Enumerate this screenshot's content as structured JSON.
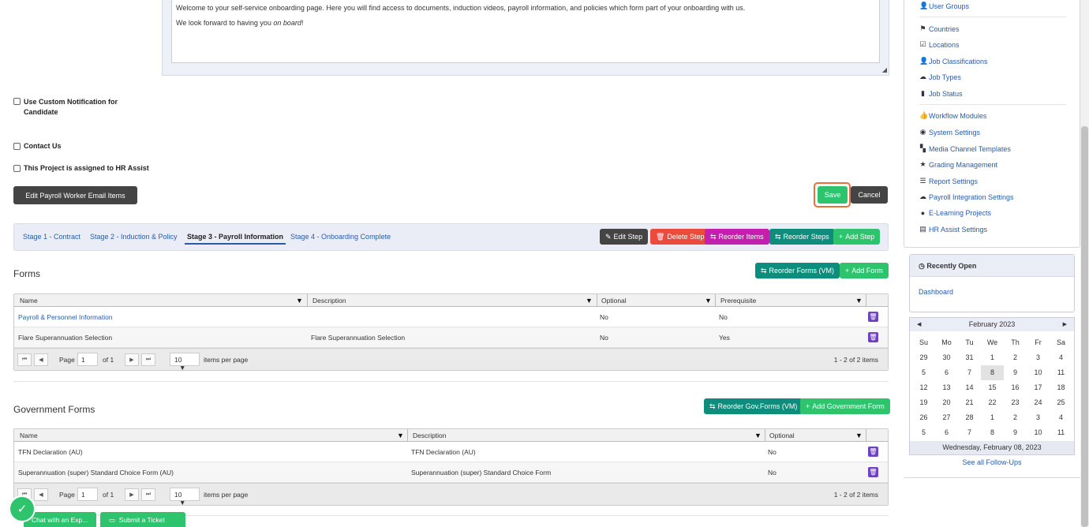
{
  "editor": {
    "line1": "Welcome to your self-service onboarding page. Here you will find access to documents, induction videos, payroll information, and policies which form part of your onboarding with us.",
    "line2_prefix": "We look forward to having you ",
    "line2_em": "on board",
    "line2_suffix": "!"
  },
  "checkboxes": {
    "custom_notification": "Use Custom Notification for Candidate",
    "contact_us": "Contact Us",
    "hr_assist": "This Project is assigned to HR Assist"
  },
  "buttons": {
    "edit_payroll": "Edit Payroll Worker Email Items",
    "save": "Save",
    "cancel": "Cancel",
    "edit_step": "Edit Step",
    "delete_step": "Delete Step",
    "reorder_items": "Reorder Items",
    "reorder_steps": "Reorder Steps",
    "add_step": "Add Step",
    "reorder_forms": "Reorder Forms (VM)",
    "add_form": "Add Form",
    "reorder_gov_forms": "Reorder Gov.Forms (VM)",
    "add_gov_form": "Add Government Form"
  },
  "stages": [
    {
      "label": "Stage 1 - Contract"
    },
    {
      "label": "Stage 2 - Induction & Policy"
    },
    {
      "label": "Stage 3 - Payroll Information"
    },
    {
      "label": "Stage 4 - Onboarding Complete"
    }
  ],
  "forms": {
    "title": "Forms",
    "columns": [
      "Name",
      "Description",
      "Optional",
      "Prerequisite"
    ],
    "rows": [
      {
        "name": "Payroll & Personnel Information",
        "description": "",
        "optional": "No",
        "prerequisite": "No"
      },
      {
        "name": "Flare Superannuation Selection",
        "description": "Flare Superannuation Selection",
        "optional": "No",
        "prerequisite": "Yes"
      }
    ],
    "pager": {
      "page_label": "Page",
      "page": "1",
      "of": "of 1",
      "per_page": "10",
      "per_page_label": "items per page",
      "summary": "1 - 2 of 2 items"
    }
  },
  "gov_forms": {
    "title": "Government Forms",
    "columns": [
      "Name",
      "Description",
      "Optional"
    ],
    "rows": [
      {
        "name": "TFN Declaration (AU)",
        "description": "TFN Declaration (AU)",
        "optional": "No"
      },
      {
        "name": "Superannuation (super) Standard Choice Form (AU)",
        "description": "Superannuation (super) Standard Choice Form",
        "optional": "No"
      }
    ],
    "pager": {
      "page_label": "Page",
      "page": "1",
      "of": "of 1",
      "per_page": "10",
      "per_page_label": "items per page",
      "summary": "1 - 2 of 2 items"
    }
  },
  "sidebar": {
    "items": [
      {
        "label": "User Groups",
        "icon": "user-icon"
      },
      {
        "label": "Countries",
        "icon": "flag-icon"
      },
      {
        "label": "Locations",
        "icon": "check-square-icon"
      },
      {
        "label": "Job Classifications",
        "icon": "user-icon"
      },
      {
        "label": "Job Types",
        "icon": "cloud-icon"
      },
      {
        "label": "Job Status",
        "icon": "book-icon"
      },
      {
        "label": "Workflow Modules",
        "icon": "thumbs-up-icon"
      },
      {
        "label": "System Settings",
        "icon": "globe-icon"
      },
      {
        "label": "Media Channel Templates",
        "icon": "media-icon"
      },
      {
        "label": "Grading Management",
        "icon": "star-icon"
      },
      {
        "label": "Report Settings",
        "icon": "list-icon"
      },
      {
        "label": "Payroll Integration Settings",
        "icon": "cloud-icon"
      },
      {
        "label": "E-Learning Projects",
        "icon": "apple-icon"
      },
      {
        "label": "HR Assist Settings",
        "icon": "briefcase-icon"
      }
    ]
  },
  "recent": {
    "title": "Recently Open",
    "item": "Dashboard"
  },
  "calendar": {
    "month": "February 2023",
    "weekdays": [
      "Su",
      "Mo",
      "Tu",
      "We",
      "Th",
      "Fr",
      "Sa"
    ],
    "days": [
      "29",
      "30",
      "31",
      "1",
      "2",
      "3",
      "4",
      "5",
      "6",
      "7",
      "8",
      "9",
      "10",
      "11",
      "12",
      "13",
      "14",
      "15",
      "16",
      "17",
      "18",
      "19",
      "20",
      "21",
      "22",
      "23",
      "24",
      "25",
      "26",
      "27",
      "28",
      "1",
      "2",
      "3",
      "4",
      "5",
      "6",
      "7",
      "8",
      "9",
      "10",
      "11"
    ],
    "selected_index": 10,
    "footer": "Wednesday, February 08, 2023",
    "follow_ups": "See all Follow-Ups"
  },
  "support": {
    "chat": "Chat with an Exp...",
    "ticket": "Submit a Ticket"
  },
  "colors": {
    "accent_green": "#2ec46d",
    "save_highlight": "#e8703c",
    "link": "#2a5ba8",
    "purple": "#6f42c1"
  }
}
